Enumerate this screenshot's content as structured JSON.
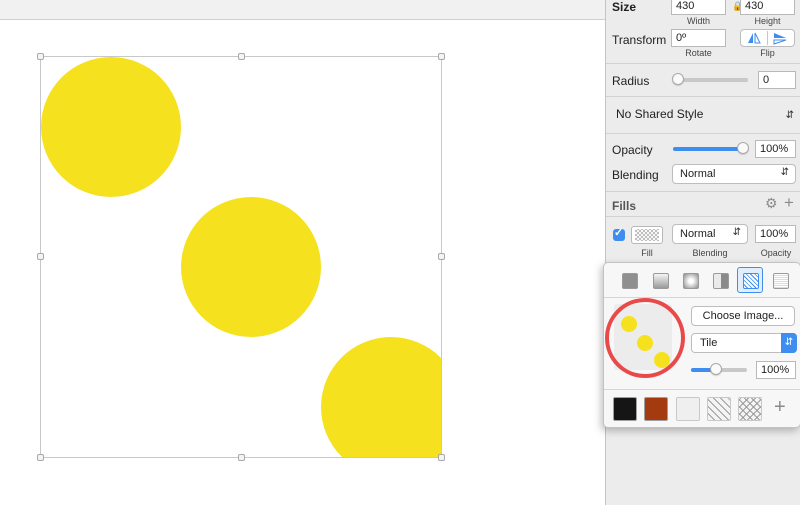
{
  "inspector": {
    "size": {
      "label": "Size",
      "width": "430",
      "height": "430",
      "width_label": "Width",
      "height_label": "Height"
    },
    "transform": {
      "label": "Transform",
      "rotate_value": "0º",
      "rotate_label": "Rotate",
      "flip_label": "Flip"
    },
    "radius": {
      "label": "Radius",
      "value": "0",
      "slider_fraction": 0
    },
    "shared_style": "No Shared Style",
    "opacity": {
      "label": "Opacity",
      "value": "100%",
      "slider_fraction": 1.0
    },
    "blending": {
      "label": "Blending",
      "value": "Normal"
    },
    "fills": {
      "title": "Fills",
      "row": {
        "checked": true,
        "blend": "Normal",
        "opacity": "100%",
        "fill_label": "Fill",
        "blending_label": "Blending",
        "opacity_label": "Opacity"
      }
    }
  },
  "popover": {
    "fill_types": [
      "solid-fill",
      "linear-gradient",
      "radial-gradient",
      "angular-gradient",
      "pattern-fill",
      "noise-fill"
    ],
    "selected_type": "pattern-fill",
    "choose_image": "Choose Image...",
    "mode": "Tile",
    "scale": "100%",
    "scale_fraction": 0.45,
    "presets": [
      "dark-texture",
      "rust-texture",
      "light-texture",
      "diagonal-lines",
      "crosshatch"
    ],
    "add_label": "+",
    "colors": {
      "highlight_circle": "#e84a4a",
      "preset_rust": "#a33a10",
      "preset_dark": "#151515"
    }
  },
  "canvas": {
    "dot_color": "#f5e11e"
  }
}
